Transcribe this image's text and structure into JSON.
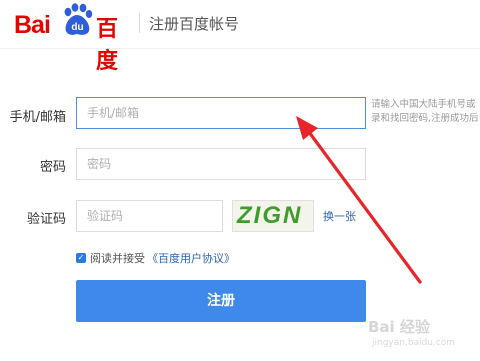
{
  "header": {
    "logo_bai": "Bai",
    "logo_du": "du",
    "logo_baidu": "百度",
    "title": "注册百度帐号"
  },
  "form": {
    "phone_label": "手机/邮箱",
    "phone_placeholder": "手机/邮箱",
    "phone_hint_line1": "请输入中国大陆手机号或",
    "phone_hint_line2": "录和找回密码,注册成功后",
    "password_label": "密码",
    "password_placeholder": "密码",
    "captcha_label": "验证码",
    "captcha_placeholder": "验证码",
    "captcha_image_text": "ZIGN",
    "refresh_label": "换一张",
    "agree_text": "阅读并接受",
    "agree_link": "《百度用户协议》",
    "submit_label": "注册"
  },
  "watermark": {
    "text": "Bai 经验",
    "sub": "jingyan.baidu.com"
  },
  "colors": {
    "brand_red": "#e10601",
    "primary_blue": "#3f89ec",
    "link_blue": "#2d64b3",
    "arrow_red": "#e8262a"
  }
}
